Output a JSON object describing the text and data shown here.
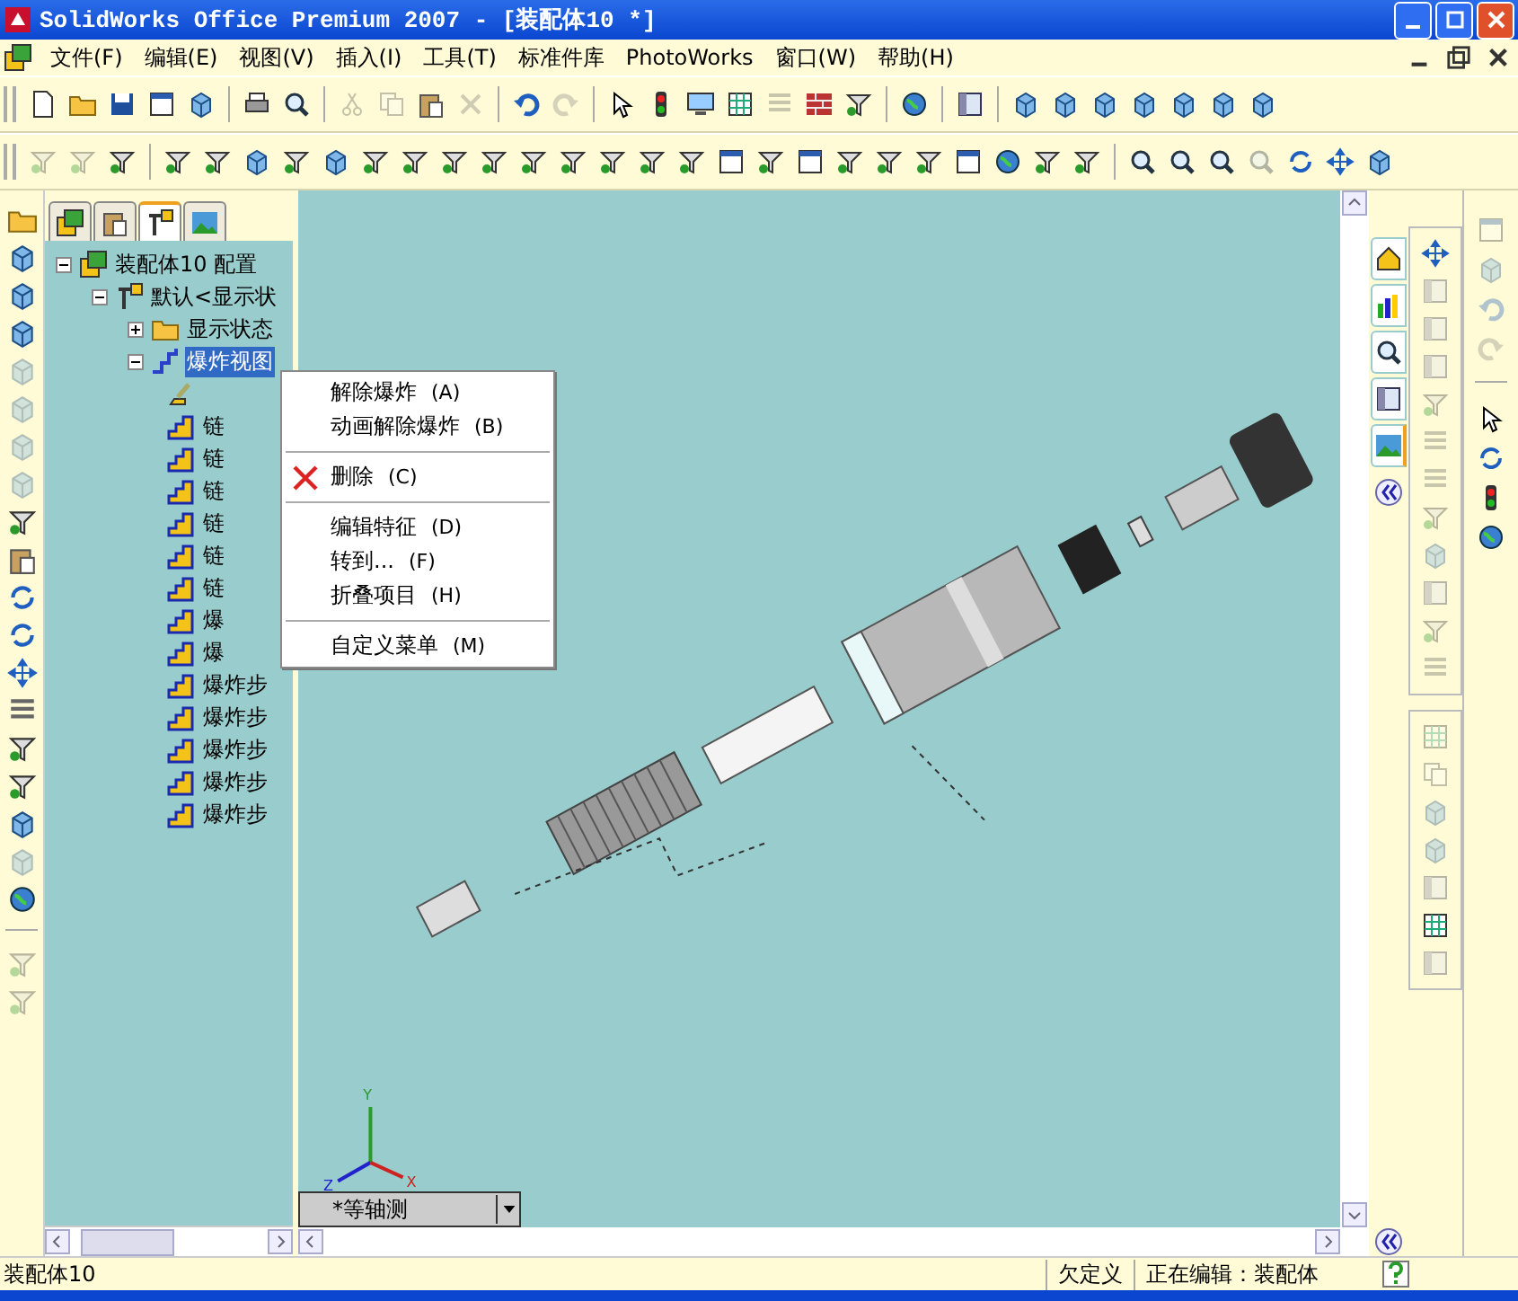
{
  "window": {
    "title": "SolidWorks Office Premium 2007 - [装配体10 *]"
  },
  "menu": [
    "文件(F)",
    "编辑(E)",
    "视图(V)",
    "插入(I)",
    "工具(T)",
    "标准件库",
    "PhotoWorks",
    "窗口(W)",
    "帮助(H)"
  ],
  "toolbar_1": [
    {
      "kind": "document",
      "disabled": false
    },
    {
      "kind": "folder",
      "disabled": false
    },
    {
      "kind": "disk",
      "disabled": false
    },
    {
      "kind": "window",
      "disabled": false
    },
    {
      "kind": "cube",
      "disabled": false
    },
    {
      "kind": "separator"
    },
    {
      "kind": "printer",
      "disabled": false
    },
    {
      "kind": "magnifier",
      "disabled": false
    },
    {
      "kind": "separator"
    },
    {
      "kind": "scissors",
      "disabled": true
    },
    {
      "kind": "copy",
      "disabled": true
    },
    {
      "kind": "paste",
      "disabled": false
    },
    {
      "kind": "cross",
      "disabled": true
    },
    {
      "kind": "separator"
    },
    {
      "kind": "undo",
      "disabled": false
    },
    {
      "kind": "redo",
      "disabled": true
    },
    {
      "kind": "separator"
    },
    {
      "kind": "pointer",
      "disabled": false
    },
    {
      "kind": "light",
      "disabled": false
    },
    {
      "kind": "monitor",
      "disabled": false
    },
    {
      "kind": "grid",
      "disabled": false
    },
    {
      "kind": "list",
      "disabled": true
    },
    {
      "kind": "bricks",
      "disabled": false
    },
    {
      "kind": "funnel",
      "disabled": false
    },
    {
      "kind": "separator"
    },
    {
      "kind": "globe",
      "disabled": false
    },
    {
      "kind": "separator"
    },
    {
      "kind": "panel",
      "disabled": false
    },
    {
      "kind": "separator"
    },
    {
      "kind": "cube",
      "disabled": false
    },
    {
      "kind": "cube",
      "disabled": false
    },
    {
      "kind": "cube",
      "disabled": false
    },
    {
      "kind": "cube",
      "disabled": false
    },
    {
      "kind": "cube",
      "disabled": false
    },
    {
      "kind": "cube",
      "disabled": false
    },
    {
      "kind": "cube",
      "disabled": false
    }
  ],
  "toolbar_2": [
    {
      "kind": "funnel",
      "disabled": true
    },
    {
      "kind": "funnel",
      "disabled": true
    },
    {
      "kind": "funnel",
      "disabled": false
    },
    {
      "kind": "separator"
    },
    {
      "kind": "funnel",
      "disabled": false
    },
    {
      "kind": "funnel",
      "disabled": false
    },
    {
      "kind": "cube",
      "disabled": false
    },
    {
      "kind": "funnel",
      "disabled": false
    },
    {
      "kind": "cube",
      "disabled": false
    },
    {
      "kind": "funnel",
      "disabled": false
    },
    {
      "kind": "funnel",
      "disabled": false
    },
    {
      "kind": "funnel",
      "disabled": false
    },
    {
      "kind": "funnel",
      "disabled": false
    },
    {
      "kind": "funnel",
      "disabled": false
    },
    {
      "kind": "funnel",
      "disabled": false
    },
    {
      "kind": "funnel",
      "disabled": false
    },
    {
      "kind": "funnel",
      "disabled": false
    },
    {
      "kind": "funnel",
      "disabled": false
    },
    {
      "kind": "window",
      "disabled": false
    },
    {
      "kind": "funnel",
      "disabled": false
    },
    {
      "kind": "window",
      "disabled": false
    },
    {
      "kind": "funnel",
      "disabled": false
    },
    {
      "kind": "funnel",
      "disabled": false
    },
    {
      "kind": "funnel",
      "disabled": false
    },
    {
      "kind": "window",
      "disabled": false
    },
    {
      "kind": "globe",
      "disabled": false
    },
    {
      "kind": "funnel",
      "disabled": false
    },
    {
      "kind": "funnel",
      "disabled": false
    },
    {
      "kind": "separator"
    },
    {
      "kind": "magnifier",
      "disabled": false
    },
    {
      "kind": "magnifier",
      "disabled": false
    },
    {
      "kind": "magnifier",
      "disabled": false
    },
    {
      "kind": "magnifier",
      "disabled": true
    },
    {
      "kind": "rotate",
      "disabled": false
    },
    {
      "kind": "move",
      "disabled": false
    },
    {
      "kind": "cube",
      "disabled": false
    }
  ],
  "left_toolbar": [
    {
      "kind": "folder",
      "disabled": false
    },
    {
      "kind": "cube",
      "disabled": false
    },
    {
      "kind": "cube",
      "disabled": false
    },
    {
      "kind": "cube",
      "disabled": false
    },
    {
      "kind": "cube",
      "disabled": true
    },
    {
      "kind": "cube",
      "disabled": true
    },
    {
      "kind": "cube",
      "disabled": true
    },
    {
      "kind": "cube",
      "disabled": true
    },
    {
      "kind": "funnel",
      "disabled": false
    },
    {
      "kind": "paste",
      "disabled": false
    },
    {
      "kind": "rotate",
      "disabled": false
    },
    {
      "kind": "rotate",
      "disabled": false
    },
    {
      "kind": "move",
      "disabled": false
    },
    {
      "kind": "list",
      "disabled": false
    },
    {
      "kind": "funnel",
      "disabled": false
    },
    {
      "kind": "funnel",
      "disabled": false
    },
    {
      "kind": "cube",
      "disabled": false
    },
    {
      "kind": "cube",
      "disabled": true
    },
    {
      "kind": "globe",
      "disabled": false
    },
    {
      "kind": "separator"
    },
    {
      "kind": "funnel",
      "disabled": true
    },
    {
      "kind": "funnel",
      "disabled": true
    }
  ],
  "feature_tabs": [
    {
      "selected": false
    },
    {
      "selected": false
    },
    {
      "selected": true
    },
    {
      "selected": false
    }
  ],
  "tree": {
    "label": "装配体10 配置",
    "kind": "assembly",
    "expanded": true,
    "children": [
      {
        "label": "默认<显示状",
        "kind": "config",
        "expanded": true,
        "children": [
          {
            "label": "显示状态",
            "kind": "folder",
            "expanded": false
          },
          {
            "label": "爆炸视图",
            "kind": "explode",
            "expanded": true,
            "selected": true,
            "children": [
              {
                "kind": "line"
              },
              {
                "label": "链",
                "kind": "step"
              },
              {
                "label": "链",
                "kind": "step"
              },
              {
                "label": "链",
                "kind": "step"
              },
              {
                "label": "链",
                "kind": "step"
              },
              {
                "label": "链",
                "kind": "step"
              },
              {
                "label": "链",
                "kind": "step"
              },
              {
                "label": "爆",
                "kind": "step"
              },
              {
                "label": "爆",
                "kind": "step"
              },
              {
                "label": "爆炸步",
                "kind": "step"
              },
              {
                "label": "爆炸步",
                "kind": "step"
              },
              {
                "label": "爆炸步",
                "kind": "step"
              },
              {
                "label": "爆炸步",
                "kind": "step"
              },
              {
                "label": "爆炸步",
                "kind": "step"
              }
            ]
          }
        ]
      }
    ]
  },
  "context_menu": [
    {
      "kind": "item",
      "label": "解除爆炸",
      "shortcut": "(A)"
    },
    {
      "kind": "item",
      "label": "动画解除爆炸",
      "shortcut": "(B)"
    },
    {
      "kind": "separator"
    },
    {
      "kind": "delete",
      "label": "删除",
      "shortcut": "(C)"
    },
    {
      "kind": "separator"
    },
    {
      "kind": "item",
      "label": "编辑特征",
      "shortcut": "(D)"
    },
    {
      "kind": "item",
      "label": "转到...",
      "shortcut": "(F)"
    },
    {
      "kind": "item",
      "label": "折叠项目",
      "shortcut": "(H)"
    },
    {
      "kind": "separator"
    },
    {
      "kind": "item",
      "label": "自定义菜单",
      "shortcut": "(M)"
    }
  ],
  "triad": {
    "x": "X",
    "y": "Y",
    "z": "Z"
  },
  "view_selector": {
    "value": "*等轴测"
  },
  "task_pane_tabs": [
    {
      "kind": "house",
      "selected": false
    },
    {
      "kind": "chart",
      "selected": false
    },
    {
      "kind": "magnifier",
      "selected": false
    },
    {
      "kind": "panel",
      "selected": false
    },
    {
      "kind": "landscape",
      "selected": true
    }
  ],
  "right_toolbar_1": [
    {
      "kind": "move",
      "disabled": false
    },
    {
      "kind": "panel",
      "disabled": true
    },
    {
      "kind": "panel",
      "disabled": true
    },
    {
      "kind": "panel",
      "disabled": true
    },
    {
      "kind": "funnel",
      "disabled": true
    },
    {
      "kind": "list",
      "disabled": true
    },
    {
      "kind": "list",
      "disabled": true
    },
    {
      "kind": "funnel",
      "disabled": true
    },
    {
      "kind": "cube",
      "disabled": true
    },
    {
      "kind": "panel",
      "disabled": true
    },
    {
      "kind": "funnel",
      "disabled": true
    },
    {
      "kind": "list",
      "disabled": true
    }
  ],
  "right_toolbar_2": [
    {
      "kind": "grid",
      "disabled": true
    },
    {
      "kind": "copy",
      "disabled": true
    },
    {
      "kind": "cube",
      "disabled": true
    },
    {
      "kind": "cube",
      "disabled": true
    },
    {
      "kind": "panel",
      "disabled": true
    },
    {
      "kind": "grid",
      "disabled": false
    },
    {
      "kind": "panel",
      "disabled": true
    }
  ],
  "right_toolbar_3": [
    {
      "kind": "window",
      "disabled": true
    },
    {
      "kind": "cube",
      "disabled": true
    },
    {
      "kind": "undo",
      "disabled": true
    },
    {
      "kind": "redo",
      "disabled": true
    },
    {
      "kind": "separator"
    },
    {
      "kind": "pointer",
      "disabled": false
    },
    {
      "kind": "rotate",
      "disabled": false
    },
    {
      "kind": "light",
      "disabled": false
    },
    {
      "kind": "globe",
      "disabled": false
    }
  ],
  "status_bar": {
    "document": "装配体10",
    "state": "欠定义",
    "editing": "正在编辑：装配体"
  }
}
